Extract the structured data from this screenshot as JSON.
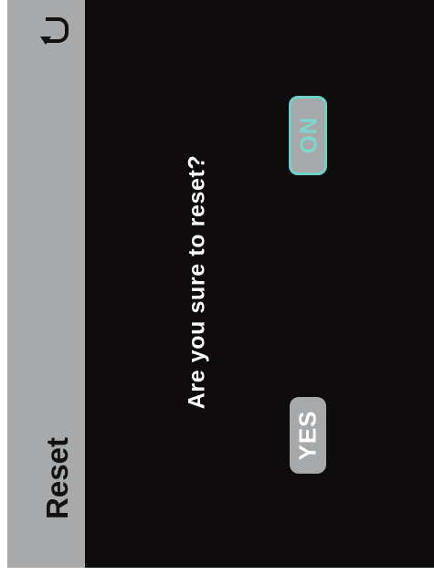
{
  "header": {
    "title": "Reset",
    "back_icon": "back-arrow-icon"
  },
  "dialog": {
    "question": "Are you sure to reset?",
    "no_label": "NO",
    "yes_label": "YES",
    "selected": "NO"
  },
  "colors": {
    "sidebar": "#a7a9ab",
    "background": "#0d0b0c",
    "accent": "#6ed0c6",
    "button": "#a6a8aa"
  }
}
